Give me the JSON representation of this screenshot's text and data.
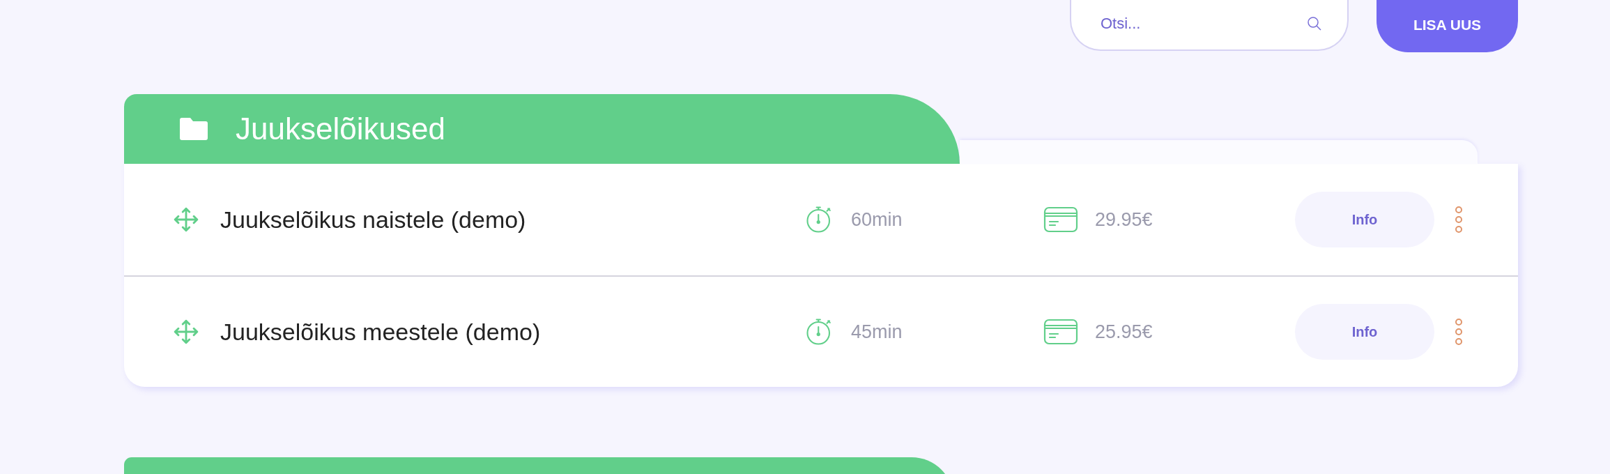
{
  "search": {
    "placeholder": "Otsi..."
  },
  "add_button": "LISA UUS",
  "group": {
    "title": "Juukselõikused",
    "services": [
      {
        "name": "Juukselõikus naistele (demo)",
        "duration": "60min",
        "price": "29.95€",
        "info": "Info"
      },
      {
        "name": "Juukselõikus meestele (demo)",
        "duration": "45min",
        "price": "25.95€",
        "info": "Info"
      }
    ]
  }
}
